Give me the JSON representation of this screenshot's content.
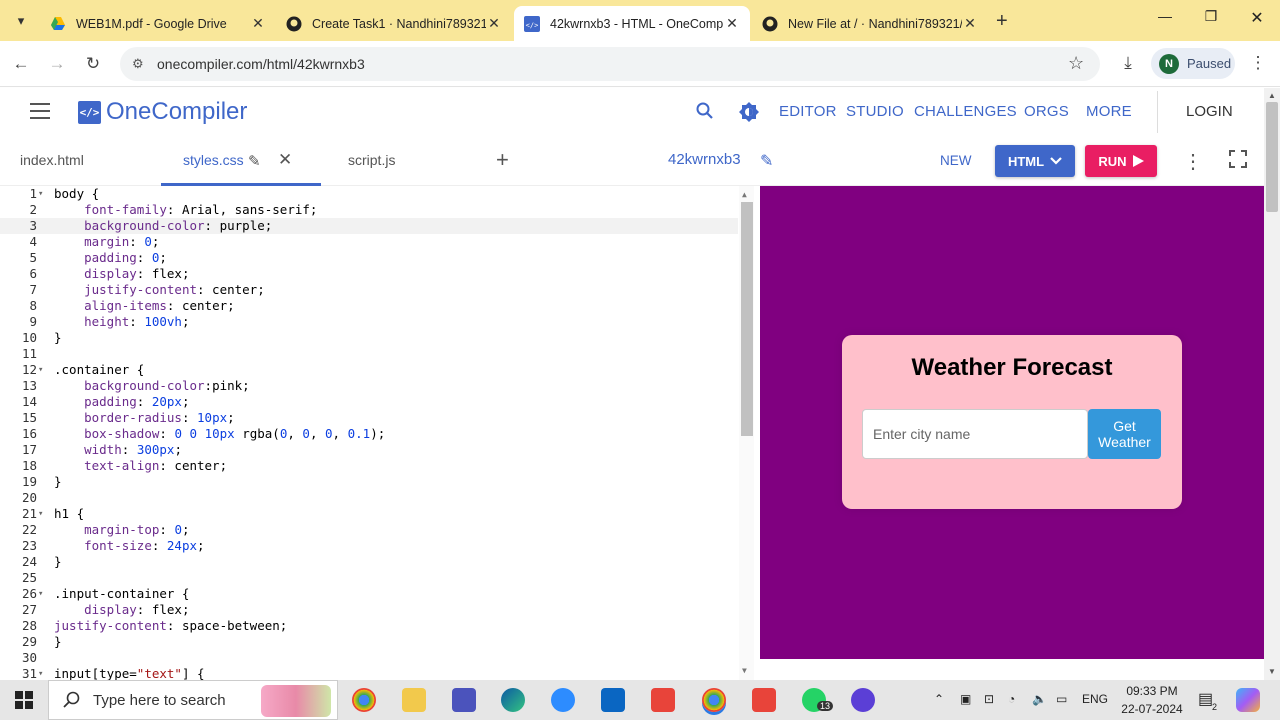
{
  "browser": {
    "tabs": [
      {
        "title": "WEB1M.pdf - Google Drive",
        "favicon": "google-drive-icon",
        "active": false
      },
      {
        "title": "Create Task1 · Nandhini789321/",
        "favicon": "github-icon",
        "active": false
      },
      {
        "title": "42kwrnxb3 - HTML - OneComp",
        "favicon": "onecompiler-icon",
        "active": true
      },
      {
        "title": "New File at / · Nandhini789321/",
        "favicon": "github-icon",
        "active": false
      }
    ],
    "url": "onecompiler.com/html/42kwrnxb3",
    "profile_initial": "N",
    "profile_status": "Paused"
  },
  "site": {
    "logo_text": "OneCompiler",
    "logo_glyph": "</>",
    "nav": [
      "EDITOR",
      "STUDIO",
      "CHALLENGES",
      "ORGS",
      "MORE"
    ],
    "login": "LOGIN",
    "brand_color": "#3f67c9"
  },
  "files": {
    "tabs": [
      "index.html",
      "styles.css",
      "script.js"
    ],
    "active": "styles.css",
    "project_name": "42kwrnxb3",
    "new_label": "NEW",
    "lang_label": "HTML",
    "run_label": "RUN"
  },
  "editor": {
    "lines": [
      {
        "n": "1",
        "fold": true,
        "code": "body {"
      },
      {
        "n": "2",
        "code": "    font-family: Arial, sans-serif;"
      },
      {
        "n": "3",
        "code": "    background-color: purple;"
      },
      {
        "n": "4",
        "code": "    margin: 0;"
      },
      {
        "n": "5",
        "code": "    padding: 0;"
      },
      {
        "n": "6",
        "code": "    display: flex;"
      },
      {
        "n": "7",
        "code": "    justify-content: center;"
      },
      {
        "n": "8",
        "code": "    align-items: center;"
      },
      {
        "n": "9",
        "code": "    height: 100vh;"
      },
      {
        "n": "10",
        "code": "}"
      },
      {
        "n": "11",
        "code": ""
      },
      {
        "n": "12",
        "fold": true,
        "code": ".container {"
      },
      {
        "n": "13",
        "code": "    background-color:pink;"
      },
      {
        "n": "14",
        "code": "    padding: 20px;"
      },
      {
        "n": "15",
        "code": "    border-radius: 10px;"
      },
      {
        "n": "16",
        "code": "    box-shadow: 0 0 10px rgba(0, 0, 0, 0.1);"
      },
      {
        "n": "17",
        "code": "    width: 300px;"
      },
      {
        "n": "18",
        "code": "    text-align: center;"
      },
      {
        "n": "19",
        "code": "}"
      },
      {
        "n": "20",
        "code": ""
      },
      {
        "n": "21",
        "fold": true,
        "code": "h1 {"
      },
      {
        "n": "22",
        "code": "    margin-top: 0;"
      },
      {
        "n": "23",
        "code": "    font-size: 24px;"
      },
      {
        "n": "24",
        "code": "}"
      },
      {
        "n": "25",
        "code": ""
      },
      {
        "n": "26",
        "fold": true,
        "code": ".input-container {"
      },
      {
        "n": "27",
        "code": "    display: flex;"
      },
      {
        "n": "28",
        "code": "justify-content: space-between;"
      },
      {
        "n": "29",
        "code": "}"
      },
      {
        "n": "30",
        "code": ""
      },
      {
        "n": "31",
        "fold": true,
        "code": "input[type=\"text\"] {"
      }
    ],
    "highlighted_line": 3
  },
  "preview": {
    "heading": "Weather Forecast",
    "input_placeholder": "Enter city name",
    "button_label": "Get Weather",
    "bg_color": "#800080",
    "card_color": "#ffc0cb",
    "button_color": "#3498db"
  },
  "taskbar": {
    "search_placeholder": "Type here to search",
    "language": "ENG",
    "time": "09:33 PM",
    "date": "22-07-2024",
    "whatsapp_badge": "13",
    "notification_badge": "2"
  }
}
